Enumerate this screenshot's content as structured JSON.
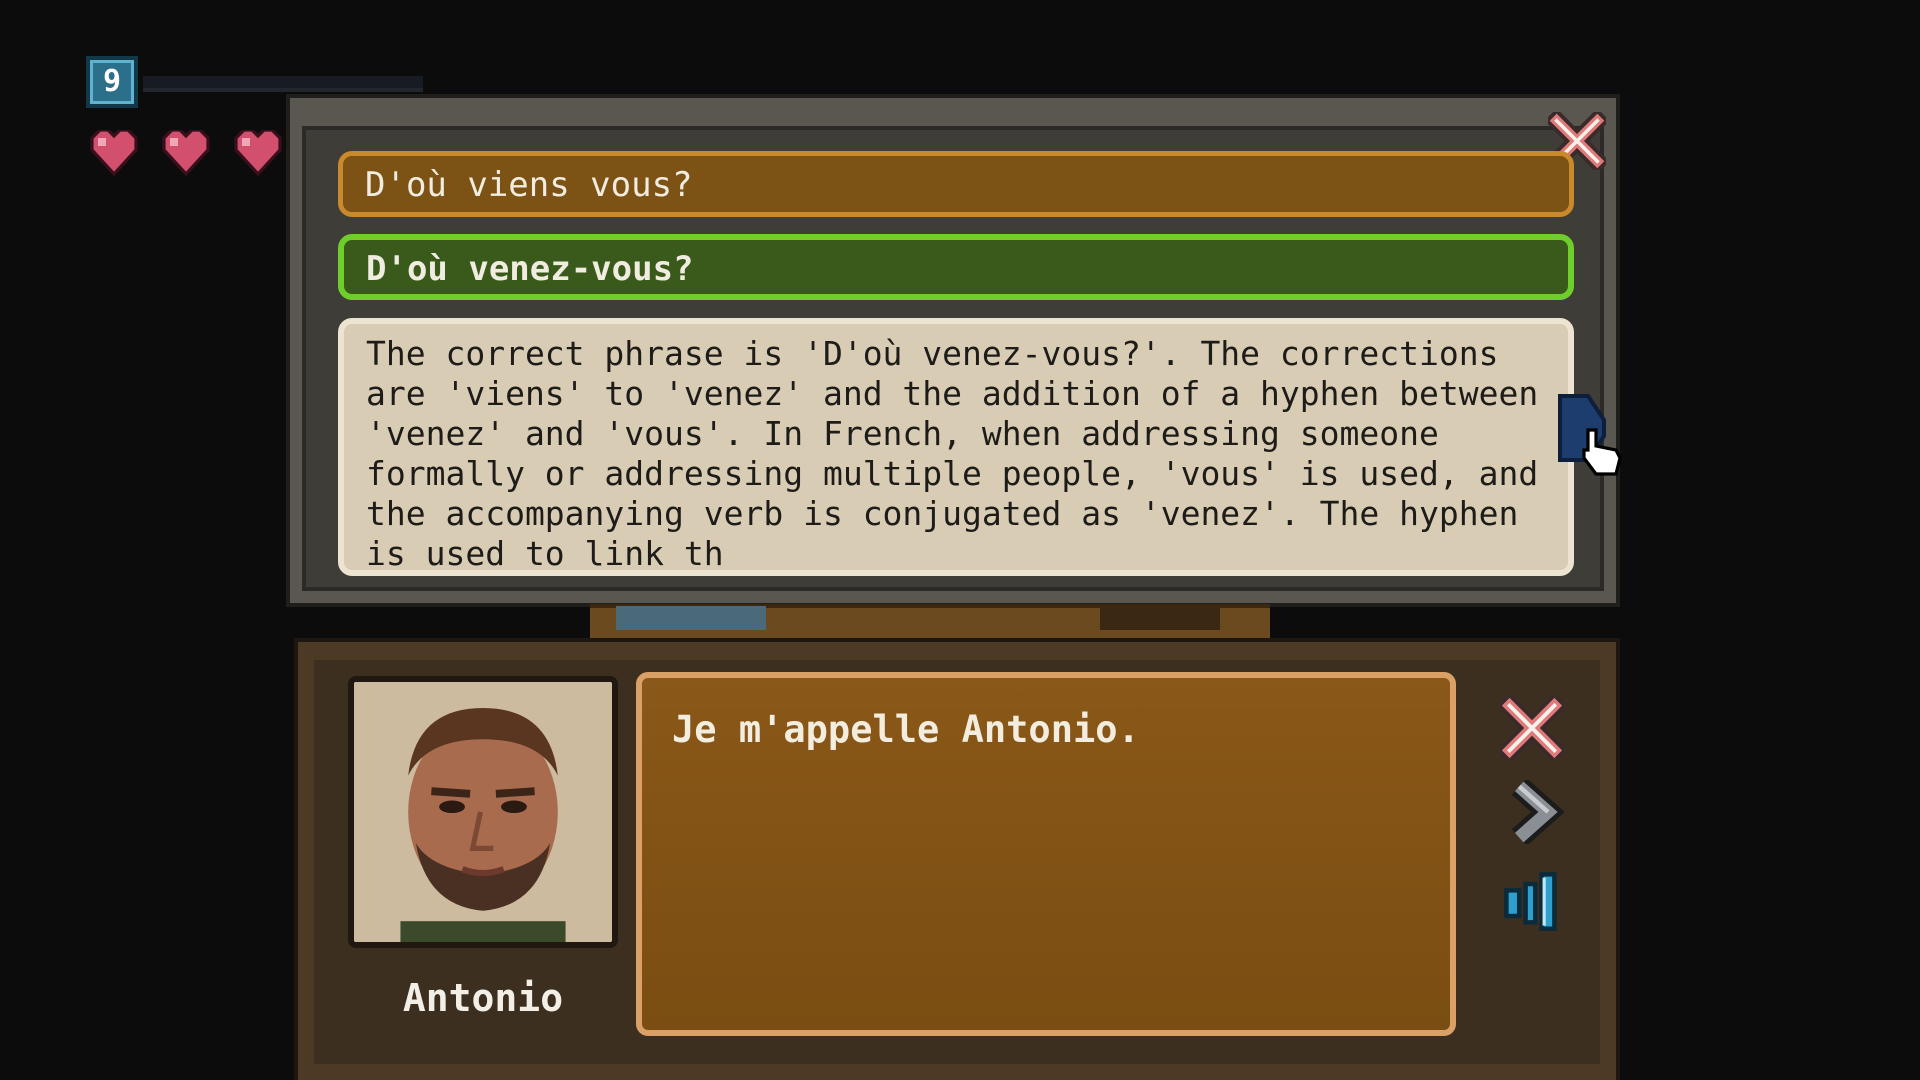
{
  "hud": {
    "level": "9",
    "xp_progress": 0.0,
    "hearts": 3,
    "heart_color": "#d2506e"
  },
  "quiz": {
    "wrong_answer": "D'où viens vous?",
    "correct_answer": "D'où venez-vous?",
    "explanation": "The correct phrase is 'D'où venez-vous?'. The corrections are 'viens' to 'venez' and the addition of a hyphen between 'venez' and 'vous'. In French, when addressing someone formally or addressing multiple people, 'vous' is used, and the accompanying verb is conjugated as 'venez'. The hyphen is used to link th",
    "icons": {
      "close": "close-icon",
      "scroll": "scroll-tab-icon"
    },
    "colors": {
      "wrong": "#c88a2a",
      "correct": "#6fcf2a"
    }
  },
  "dialog": {
    "speaker_name": "Antonio",
    "line": "Je m'appelle Antonio.",
    "buttons": {
      "close": "close-icon",
      "next": "chevron-right-icon",
      "audio": "speaker-icon"
    }
  }
}
